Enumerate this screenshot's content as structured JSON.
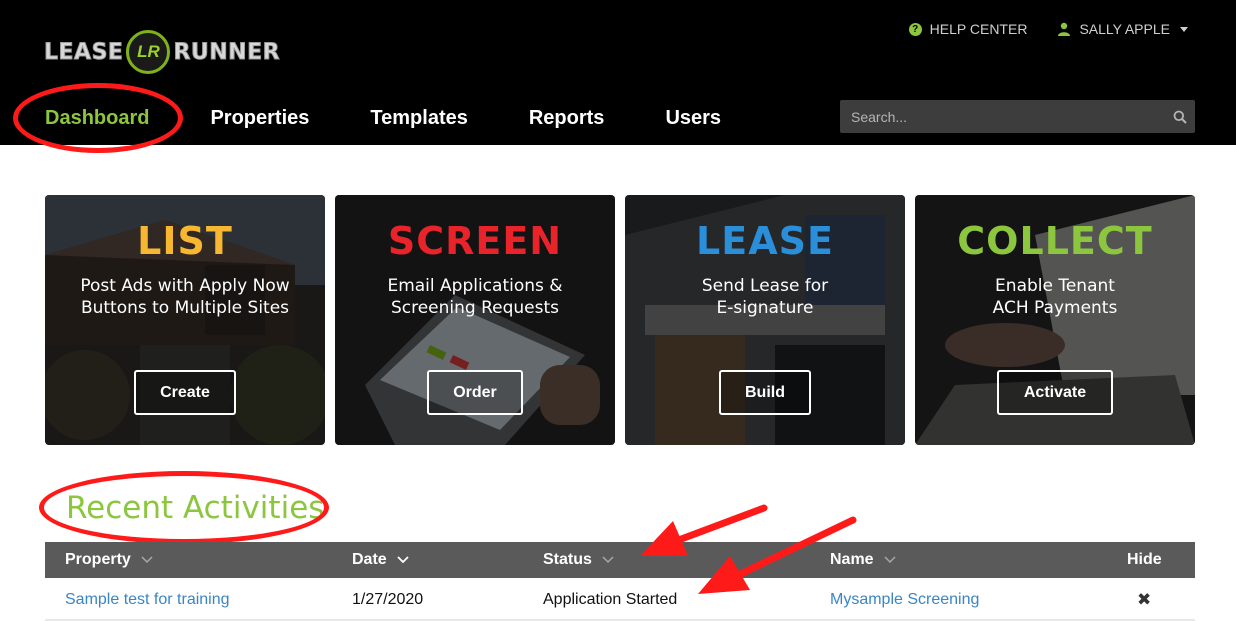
{
  "header": {
    "logo": {
      "left": "LEASE",
      "badge": "LR",
      "right": "RUNNER"
    },
    "help_center": "HELP CENTER",
    "user_name": "SALLY APPLE",
    "nav": [
      "Dashboard",
      "Properties",
      "Templates",
      "Reports",
      "Users"
    ],
    "active_nav": "Dashboard",
    "search": {
      "placeholder": "Search..."
    }
  },
  "cards": [
    {
      "title": "LIST",
      "color": "#f7b731",
      "desc": [
        "Post Ads with Apply Now",
        "Buttons to Multiple Sites"
      ],
      "button": "Create"
    },
    {
      "title": "SCREEN",
      "color": "#e8232a",
      "desc": [
        "Email Applications &",
        "Screening Requests"
      ],
      "button": "Order"
    },
    {
      "title": "LEASE",
      "color": "#2a8fd8",
      "desc": [
        "Send Lease for",
        "E-signature"
      ],
      "button": "Build"
    },
    {
      "title": "COLLECT",
      "color": "#8cc63f",
      "desc": [
        "Enable Tenant",
        "ACH Payments"
      ],
      "button": "Activate"
    }
  ],
  "recent": {
    "title": "Recent Activities",
    "columns": [
      "Property",
      "Date",
      "Status",
      "Name",
      "Hide"
    ],
    "rows": [
      {
        "property": "Sample test for training",
        "date": "1/27/2020",
        "status": "Application Started",
        "name": "Mysample Screening",
        "hide": "✖"
      }
    ]
  },
  "colors": {
    "accent_green": "#8cc63f",
    "link_blue": "#3a85c6",
    "annotation_red": "#ff1a1a",
    "table_header": "#5a5a5a"
  }
}
